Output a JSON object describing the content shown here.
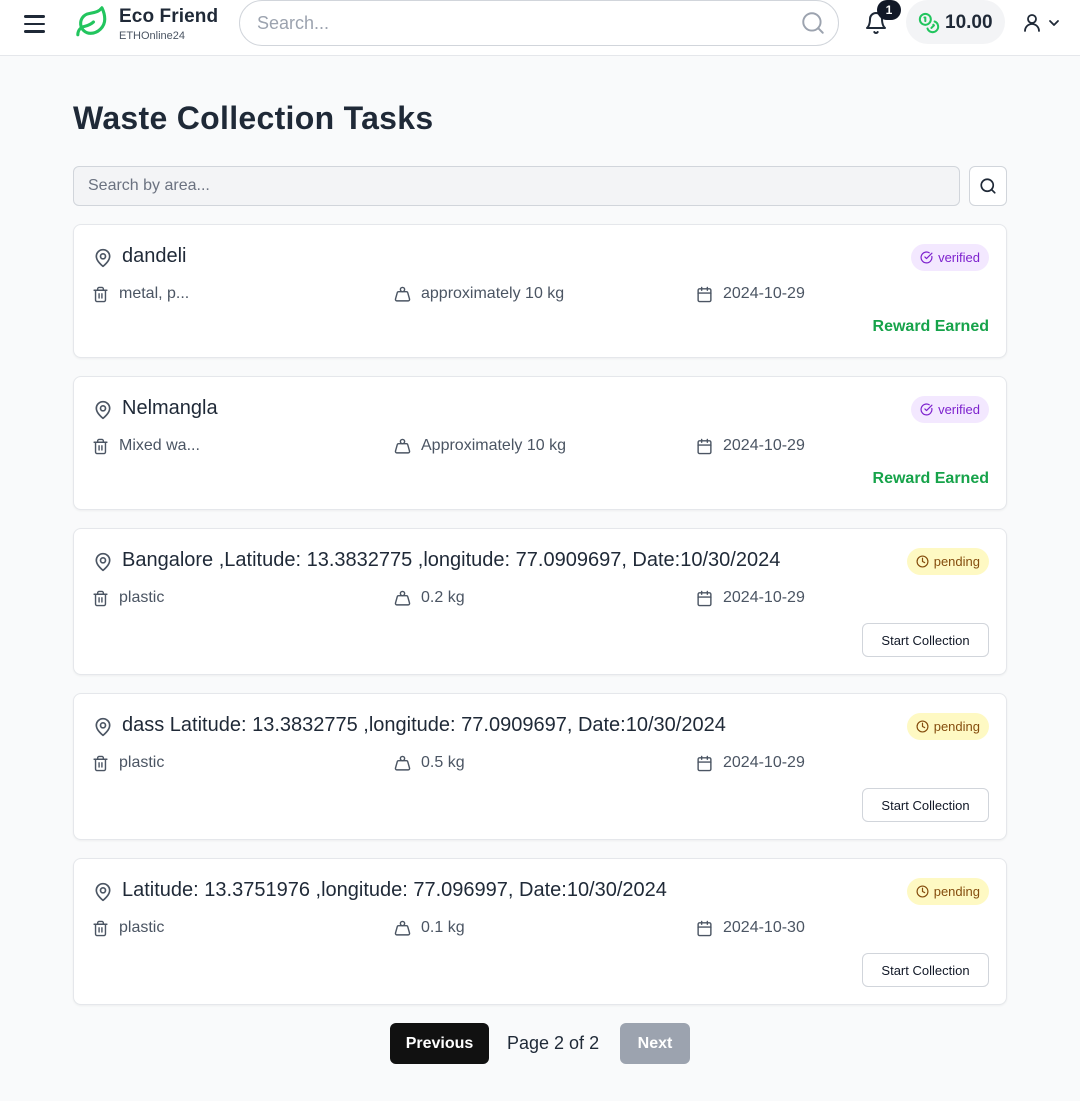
{
  "header": {
    "brand_title": "Eco Friend",
    "brand_subtitle": "ETHOnline24",
    "search_placeholder": "Search...",
    "notification_count": "1",
    "balance": "10.00",
    "brand_color": "#22c55e"
  },
  "main": {
    "title": "Waste Collection Tasks",
    "area_search_placeholder": "Search by area...",
    "tasks": [
      {
        "location": "dandeli",
        "status": "verified",
        "waste_type": "metal, p...",
        "amount": "approximately 10 kg",
        "date": "2024-10-29",
        "action": "Reward Earned"
      },
      {
        "location": "Nelmangla",
        "status": "verified",
        "waste_type": "Mixed wa...",
        "amount": "Approximately 10 kg",
        "date": "2024-10-29",
        "action": "Reward Earned"
      },
      {
        "location": "Bangalore ,Latitude: 13.3832775 ,longitude: 77.0909697, Date:10/30/2024",
        "status": "pending",
        "waste_type": "plastic",
        "amount": "0.2 kg",
        "date": "2024-10-29",
        "action": "Start Collection"
      },
      {
        "location": "dass Latitude: 13.3832775 ,longitude: 77.0909697, Date:10/30/2024",
        "status": "pending",
        "waste_type": "plastic",
        "amount": "0.5 kg",
        "date": "2024-10-29",
        "action": "Start Collection"
      },
      {
        "location": "Latitude: 13.3751976 ,longitude: 77.096997, Date:10/30/2024",
        "status": "pending",
        "waste_type": "plastic",
        "amount": "0.1 kg",
        "date": "2024-10-30",
        "action": "Start Collection"
      }
    ]
  },
  "pagination": {
    "previous_label": "Previous",
    "page_info": "Page 2 of 2",
    "next_label": "Next"
  },
  "icons": {
    "menu": "menu-icon",
    "logo": "leaf-icon",
    "search": "search-icon",
    "bell": "bell-icon",
    "coins": "coins-icon",
    "user": "user-icon",
    "chevron": "chevron-down-icon",
    "pin": "map-pin-icon",
    "trash": "trash-icon",
    "weight": "weight-icon",
    "calendar": "calendar-icon",
    "check": "circle-check-icon",
    "clock": "clock-icon"
  }
}
